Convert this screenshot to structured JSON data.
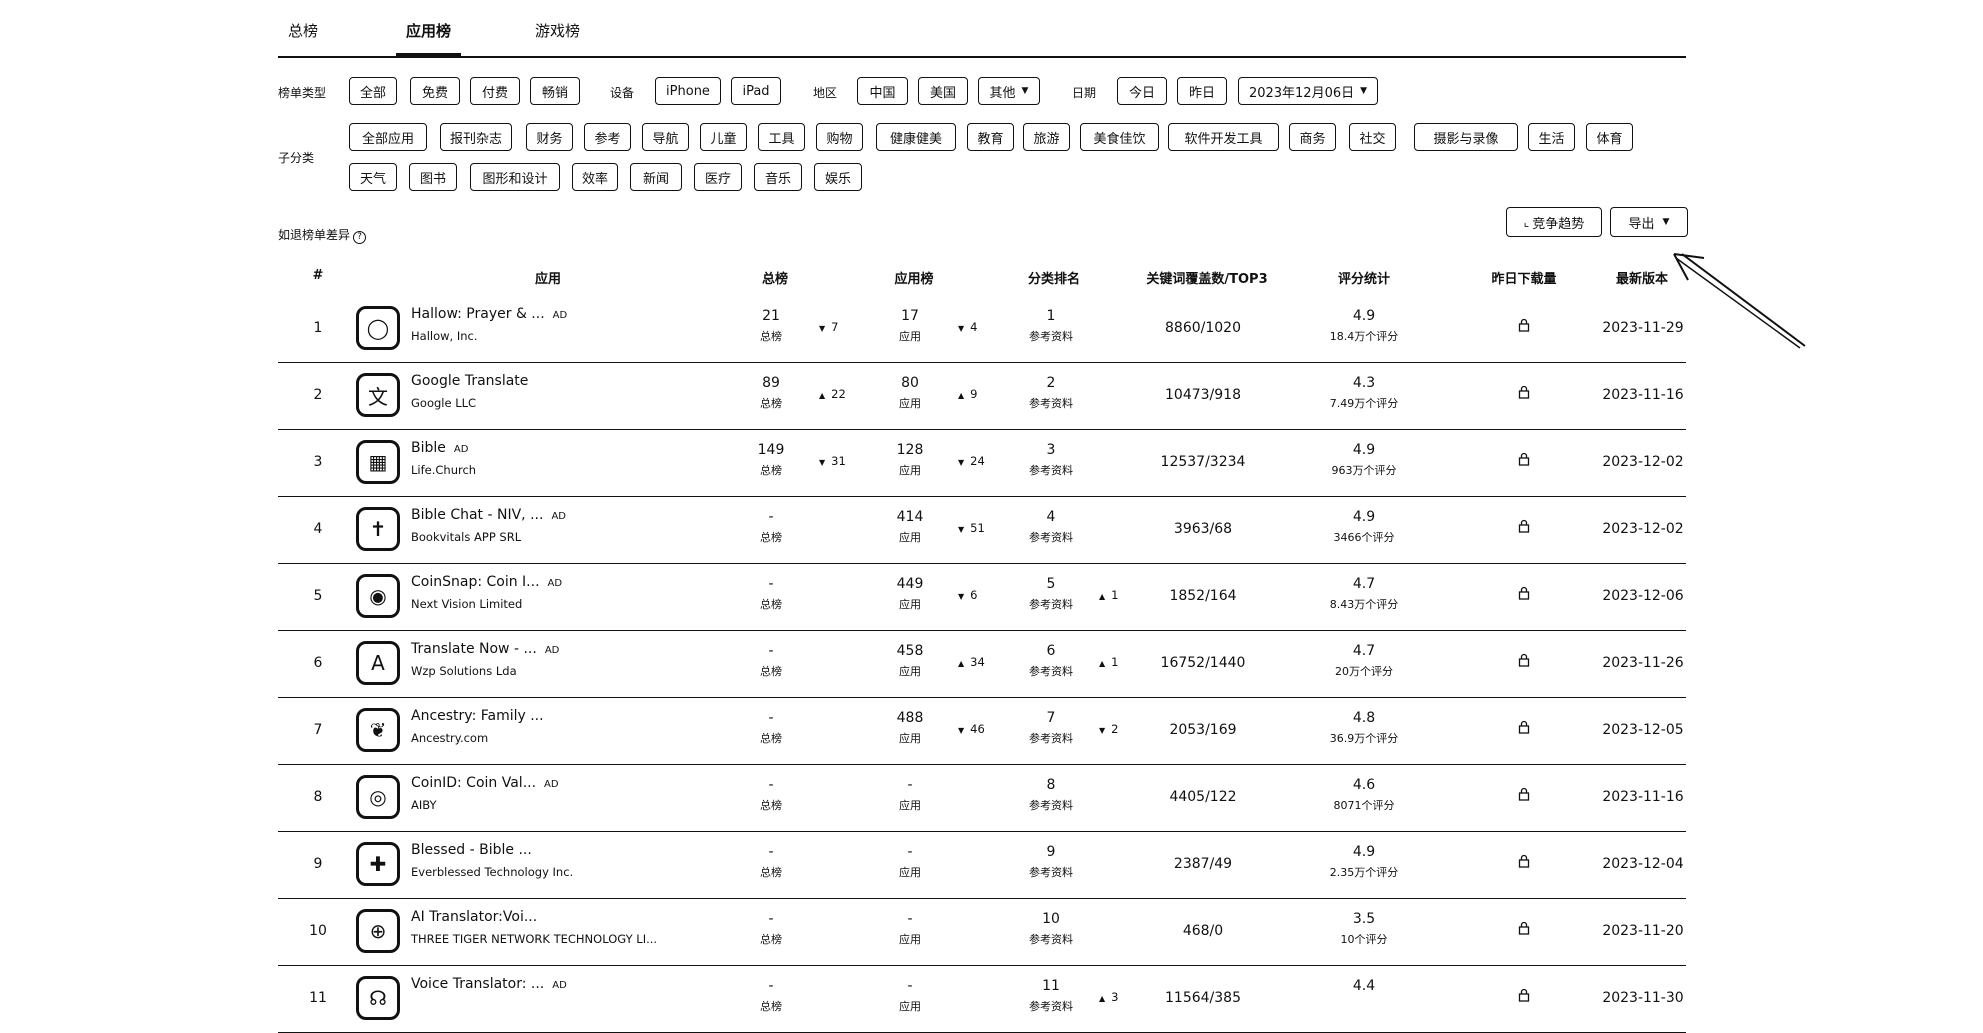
{
  "tabs": [
    "总榜",
    "应用榜",
    "游戏榜"
  ],
  "filters": {
    "list_type_label": "榜单类型",
    "list_types": [
      "全部",
      "免费",
      "付费",
      "畅销"
    ],
    "device_label": "设备",
    "devices": [
      "iPhone",
      "iPad"
    ],
    "region_label": "地区",
    "regions": [
      "中国",
      "美国"
    ],
    "region_more": "其他",
    "date_label": "日期",
    "dates": [
      "今日",
      "昨日"
    ],
    "date_selected": "2023年12月06日",
    "subcat_label": "子分类",
    "subcats_row1": [
      "全部应用",
      "报刊杂志",
      "财务",
      "参考",
      "导航",
      "儿童",
      "工具",
      "购物",
      "健康健美",
      "教育",
      "旅游",
      "美食佳饮",
      "软件开发工具",
      "商务",
      "社交",
      "摄影与录像",
      "生活",
      "体育"
    ],
    "subcats_row2": [
      "天气",
      "图书",
      "图形和设计",
      "效率",
      "新闻",
      "医疗",
      "音乐",
      "娱乐"
    ]
  },
  "hint": "如退榜单差异",
  "hint_icon": "question-icon",
  "actions": {
    "trend": "竞争趋势",
    "export": "导出"
  },
  "table": {
    "headers": [
      "#",
      "应用",
      "总榜",
      "应用榜",
      "分类排名",
      "关键词覆盖数/TOP3",
      "评分统计",
      "昨日下载量",
      "最新版本"
    ],
    "rows": [
      {
        "rank": "1",
        "name": "Hallow: Prayer & ...",
        "ad": "AD",
        "dev": "Hallow, Inc.",
        "icon": "ring-icon",
        "total": "21",
        "total_sub": "总榜",
        "total_dir": "down",
        "total_chg": "7",
        "app": "17",
        "app_sub": "应用",
        "app_dir": "down",
        "app_chg": "4",
        "cat": "1",
        "cat_sub": "参考资料",
        "cat_dir": "",
        "cat_chg": "",
        "kw": "8860/1020",
        "rating": "4.9",
        "rating_sub": "18.4万个评分",
        "date": "2023-11-29"
      },
      {
        "rank": "2",
        "name": "Google Translate",
        "ad": "",
        "dev": "Google LLC",
        "icon": "translate-icon",
        "total": "89",
        "total_sub": "总榜",
        "total_dir": "up",
        "total_chg": "22",
        "app": "80",
        "app_sub": "应用",
        "app_dir": "up",
        "app_chg": "9",
        "cat": "2",
        "cat_sub": "参考资料",
        "cat_dir": "",
        "cat_chg": "",
        "kw": "10473/918",
        "rating": "4.3",
        "rating_sub": "7.49万个评分",
        "date": "2023-11-16"
      },
      {
        "rank": "3",
        "name": "Bible",
        "ad": "AD",
        "dev": "Life.Church",
        "icon": "bible-icon",
        "total": "149",
        "total_sub": "总榜",
        "total_dir": "down",
        "total_chg": "31",
        "app": "128",
        "app_sub": "应用",
        "app_dir": "down",
        "app_chg": "24",
        "cat": "3",
        "cat_sub": "参考资料",
        "cat_dir": "",
        "cat_chg": "",
        "kw": "12537/3234",
        "rating": "4.9",
        "rating_sub": "963万个评分",
        "date": "2023-12-02"
      },
      {
        "rank": "4",
        "name": "Bible Chat - NIV, ...",
        "ad": "AD",
        "dev": "Bookvitals APP SRL",
        "icon": "cross-icon",
        "total": "-",
        "total_sub": "总榜",
        "total_dir": "",
        "total_chg": "",
        "app": "414",
        "app_sub": "应用",
        "app_dir": "down",
        "app_chg": "51",
        "cat": "4",
        "cat_sub": "参考资料",
        "cat_dir": "",
        "cat_chg": "",
        "kw": "3963/68",
        "rating": "4.9",
        "rating_sub": "3466个评分",
        "date": "2023-12-02"
      },
      {
        "rank": "5",
        "name": "CoinSnap: Coin I...",
        "ad": "AD",
        "dev": "Next Vision Limited",
        "icon": "coin-icon",
        "total": "-",
        "total_sub": "总榜",
        "total_dir": "",
        "total_chg": "",
        "app": "449",
        "app_sub": "应用",
        "app_dir": "down",
        "app_chg": "6",
        "cat": "5",
        "cat_sub": "参考资料",
        "cat_dir": "up",
        "cat_chg": "1",
        "kw": "1852/164",
        "rating": "4.7",
        "rating_sub": "8.43万个评分",
        "date": "2023-12-06"
      },
      {
        "rank": "6",
        "name": "Translate Now - ...",
        "ad": "AD",
        "dev": "Wzp Solutions Lda",
        "icon": "translate-now-icon",
        "total": "-",
        "total_sub": "总榜",
        "total_dir": "",
        "total_chg": "",
        "app": "458",
        "app_sub": "应用",
        "app_dir": "up",
        "app_chg": "34",
        "cat": "6",
        "cat_sub": "参考资料",
        "cat_dir": "up",
        "cat_chg": "1",
        "kw": "16752/1440",
        "rating": "4.7",
        "rating_sub": "20万个评分",
        "date": "2023-11-26"
      },
      {
        "rank": "7",
        "name": "Ancestry: Family ...",
        "ad": "",
        "dev": "Ancestry.com",
        "icon": "leaf-icon",
        "total": "-",
        "total_sub": "总榜",
        "total_dir": "",
        "total_chg": "",
        "app": "488",
        "app_sub": "应用",
        "app_dir": "down",
        "app_chg": "46",
        "cat": "7",
        "cat_sub": "参考资料",
        "cat_dir": "down",
        "cat_chg": "2",
        "kw": "2053/169",
        "rating": "4.8",
        "rating_sub": "36.9万个评分",
        "date": "2023-12-05"
      },
      {
        "rank": "8",
        "name": "CoinID: Coin Val...",
        "ad": "AD",
        "dev": "AIBY",
        "icon": "coin-id-icon",
        "total": "-",
        "total_sub": "总榜",
        "total_dir": "",
        "total_chg": "",
        "app": "-",
        "app_sub": "应用",
        "app_dir": "",
        "app_chg": "",
        "cat": "8",
        "cat_sub": "参考资料",
        "cat_dir": "",
        "cat_chg": "",
        "kw": "4405/122",
        "rating": "4.6",
        "rating_sub": "8071个评分",
        "date": "2023-11-16"
      },
      {
        "rank": "9",
        "name": "Blessed - Bible ...",
        "ad": "",
        "dev": "Everblessed Technology Inc.",
        "icon": "blessed-icon",
        "total": "-",
        "total_sub": "总榜",
        "total_dir": "",
        "total_chg": "",
        "app": "-",
        "app_sub": "应用",
        "app_dir": "",
        "app_chg": "",
        "cat": "9",
        "cat_sub": "参考资料",
        "cat_dir": "",
        "cat_chg": "",
        "kw": "2387/49",
        "rating": "4.9",
        "rating_sub": "2.35万个评分",
        "date": "2023-12-04"
      },
      {
        "rank": "10",
        "name": "AI Translator:Voi...",
        "ad": "",
        "dev": "THREE TIGER NETWORK TECHNOLOGY LI...",
        "icon": "globe-icon",
        "total": "-",
        "total_sub": "总榜",
        "total_dir": "",
        "total_chg": "",
        "app": "-",
        "app_sub": "应用",
        "app_dir": "",
        "app_chg": "",
        "cat": "10",
        "cat_sub": "参考资料",
        "cat_dir": "",
        "cat_chg": "",
        "kw": "468/0",
        "rating": "3.5",
        "rating_sub": "10个评分",
        "date": "2023-11-20"
      },
      {
        "rank": "11",
        "name": "Voice Translator: ...",
        "ad": "AD",
        "dev": "",
        "icon": "voice-icon",
        "total": "-",
        "total_sub": "总榜",
        "total_dir": "",
        "total_chg": "",
        "app": "-",
        "app_sub": "应用",
        "app_dir": "",
        "app_chg": "",
        "cat": "11",
        "cat_sub": "参考资料",
        "cat_dir": "up",
        "cat_chg": "3",
        "kw": "11564/385",
        "rating": "4.4",
        "rating_sub": "",
        "date": "2023-11-30"
      }
    ]
  }
}
